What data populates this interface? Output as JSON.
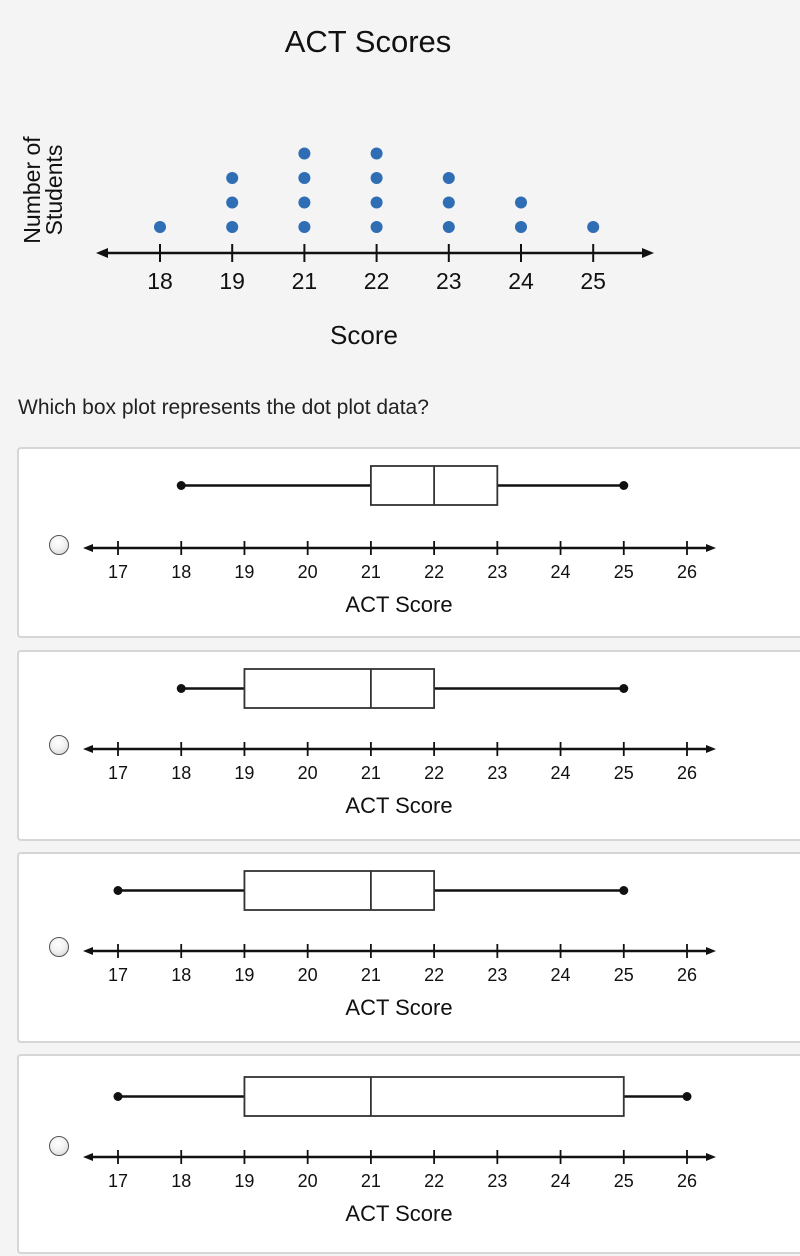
{
  "question": "Which box plot represents the dot plot data?",
  "colors": {
    "dot": "#2f6db5",
    "ink": "#111111",
    "panel_border": "#d6d6d6",
    "background": "#f4f4f4"
  },
  "chart_data": [
    {
      "type": "scatter",
      "subtype": "dot-plot",
      "title": "ACT Scores",
      "xlabel": "Score",
      "ylabel": "Number of Students",
      "x_ticks": [
        "18",
        "19",
        "21",
        "22",
        "23",
        "24",
        "25"
      ],
      "categories": [
        "18",
        "19",
        "21",
        "22",
        "23",
        "24",
        "25"
      ],
      "values": [
        1,
        3,
        4,
        4,
        3,
        2,
        1
      ]
    },
    {
      "type": "box",
      "option": 1,
      "selected": false,
      "xlabel": "ACT Score",
      "x_ticks": [
        "17",
        "18",
        "19",
        "20",
        "21",
        "22",
        "23",
        "24",
        "25",
        "26"
      ],
      "xlim": [
        17,
        26
      ],
      "min": 18,
      "q1": 21,
      "median": 22,
      "q3": 23,
      "max": 25
    },
    {
      "type": "box",
      "option": 2,
      "selected": false,
      "xlabel": "ACT Score",
      "x_ticks": [
        "17",
        "18",
        "19",
        "20",
        "21",
        "22",
        "23",
        "24",
        "25",
        "26"
      ],
      "xlim": [
        17,
        26
      ],
      "min": 18,
      "q1": 19,
      "median": 21,
      "q3": 22,
      "max": 25
    },
    {
      "type": "box",
      "option": 3,
      "selected": false,
      "xlabel": "ACT Score",
      "x_ticks": [
        "17",
        "18",
        "19",
        "20",
        "21",
        "22",
        "23",
        "24",
        "25",
        "26"
      ],
      "xlim": [
        17,
        26
      ],
      "min": 17,
      "q1": 19,
      "median": 21,
      "q3": 22,
      "max": 25
    },
    {
      "type": "box",
      "option": 4,
      "selected": false,
      "xlabel": "ACT Score",
      "x_ticks": [
        "17",
        "18",
        "19",
        "20",
        "21",
        "22",
        "23",
        "24",
        "25",
        "26"
      ],
      "xlim": [
        17,
        26
      ],
      "min": 17,
      "q1": 19,
      "median": 21,
      "q3": 25,
      "max": 26
    }
  ]
}
